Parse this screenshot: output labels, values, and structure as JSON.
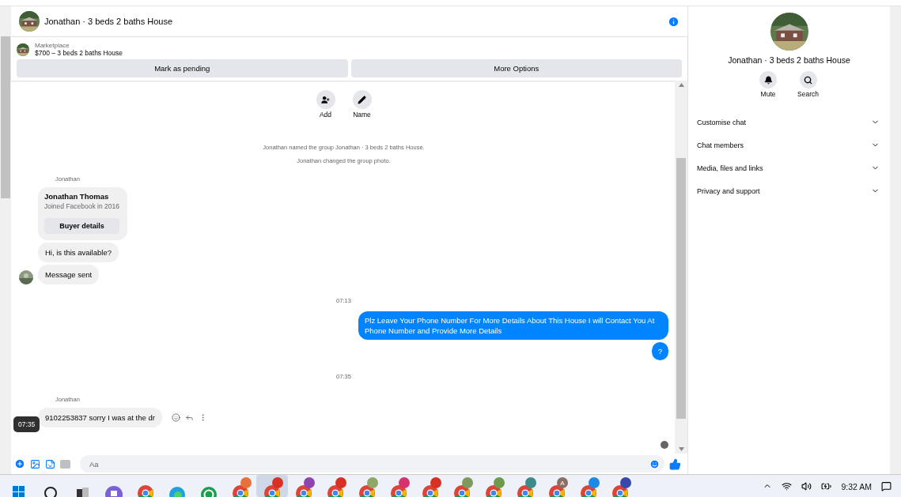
{
  "header": {
    "title": "Jonathan · 3 beds 2 baths House"
  },
  "listing": {
    "source": "Marketplace",
    "title": "$700 – 3 beds 2 baths House",
    "buttons": [
      "Mark as pending",
      "More Options"
    ]
  },
  "actions": [
    {
      "kind": "add",
      "label": "Add"
    },
    {
      "kind": "name",
      "label": "Name"
    }
  ],
  "events": [
    "Jonathan named the group Jonathan · 3 beds 2 baths House.",
    "Jonathan changed the group photo."
  ],
  "messages": [
    {
      "kind": "sender",
      "text": "Jonathan"
    },
    {
      "kind": "card",
      "name": "Jonathan Thomas",
      "subtitle": "Joined Facebook in 2016",
      "button": "Buyer details"
    },
    {
      "kind": "incoming",
      "text": "Hi, is this available?",
      "avatar": false
    },
    {
      "kind": "incoming",
      "text": "Message sent",
      "avatar": true
    },
    {
      "kind": "time",
      "text": "07:13"
    },
    {
      "kind": "outgoing",
      "text": "Plz Leave Your Phone Number For More Details About This House I will Contact You At Phone Number and Provide More Details"
    },
    {
      "kind": "outgoing",
      "text": "?"
    },
    {
      "kind": "time",
      "text": "07:35"
    },
    {
      "kind": "sender",
      "text": "Jonathan"
    },
    {
      "kind": "incoming",
      "text": "9102253837 sorry I was at the dr",
      "avatar": false,
      "hovered": true,
      "tooltip": "07:35"
    }
  ],
  "composer": {
    "placeholder": "Aa"
  },
  "details": {
    "title": "Jonathan · 3 beds 2 baths House",
    "buttons": [
      {
        "kind": "mute",
        "label": "Mute"
      },
      {
        "kind": "search",
        "label": "Search"
      }
    ],
    "sections": [
      {
        "label": "Customise chat",
        "expanded": false
      },
      {
        "label": "Chat members",
        "expanded": false
      },
      {
        "label": "Media, files and links",
        "expanded": false
      },
      {
        "label": "Privacy and support",
        "expanded": false
      }
    ]
  },
  "taskbar": {
    "apps": [
      {
        "kind": "start"
      },
      {
        "kind": "search"
      },
      {
        "kind": "taskview"
      },
      {
        "kind": "meet"
      },
      {
        "kind": "chrome"
      },
      {
        "kind": "edge"
      },
      {
        "kind": "whatsapp"
      },
      {
        "kind": "profile",
        "color": "#e8703a",
        "selected": false
      },
      {
        "kind": "profile",
        "color": "#d93025",
        "selected": true
      },
      {
        "kind": "profile",
        "color": "#8e44ad",
        "selected": false
      },
      {
        "kind": "profile",
        "color": "#d93025",
        "selected": false
      },
      {
        "kind": "profile",
        "color": "#8fa86a",
        "selected": false
      },
      {
        "kind": "profile",
        "color": "#d6336c",
        "selected": false
      },
      {
        "kind": "profile",
        "color": "#d93025",
        "selected": false
      },
      {
        "kind": "profile",
        "color": "#7d9a5c",
        "selected": false
      },
      {
        "kind": "profile",
        "color": "#6f9a4c",
        "selected": false
      },
      {
        "kind": "profile",
        "color": "#3d8a8a",
        "selected": false
      },
      {
        "kind": "profile",
        "color": "#8d6e63",
        "selected": false,
        "letter": "A"
      },
      {
        "kind": "profile",
        "color": "#1e88e5",
        "selected": false
      },
      {
        "kind": "profile",
        "color": "#3949ab",
        "selected": false
      }
    ],
    "time": "9:32 AM"
  }
}
